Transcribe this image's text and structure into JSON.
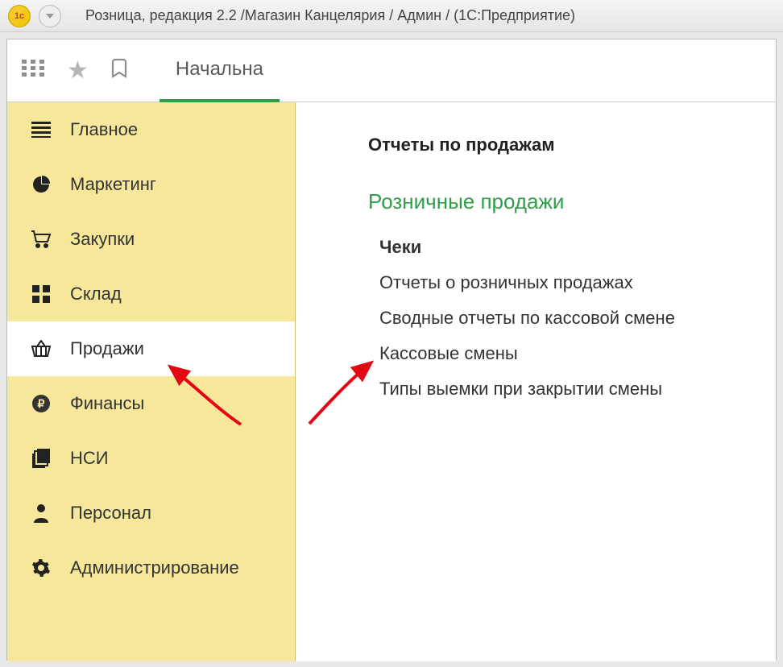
{
  "titlebar": {
    "logo_text": "1c",
    "title": "Розница, редакция 2.2 /Магазин Канцелярия / Админ /  (1С:Предприятие)"
  },
  "toolbar": {
    "tab_label": "Начальна"
  },
  "sidebar": {
    "items": [
      {
        "label": "Главное",
        "icon": "menu-icon"
      },
      {
        "label": "Маркетинг",
        "icon": "piechart-icon"
      },
      {
        "label": "Закупки",
        "icon": "cart-icon"
      },
      {
        "label": "Склад",
        "icon": "grid4-icon"
      },
      {
        "label": "Продажи",
        "icon": "basket-icon"
      },
      {
        "label": "Финансы",
        "icon": "ruble-icon"
      },
      {
        "label": "НСИ",
        "icon": "stack-icon"
      },
      {
        "label": "Персонал",
        "icon": "person-icon"
      },
      {
        "label": "Администрирование",
        "icon": "gear-icon"
      }
    ],
    "active_index": 4
  },
  "content": {
    "top_link": "Отчеты по продажам",
    "section": "Розничные продажи",
    "links": [
      "Чеки",
      "Отчеты о розничных продажах",
      "Сводные отчеты по кассовой смене",
      "Кассовые смены",
      "Типы выемки при закрытии смены"
    ],
    "bold_index": 0
  }
}
